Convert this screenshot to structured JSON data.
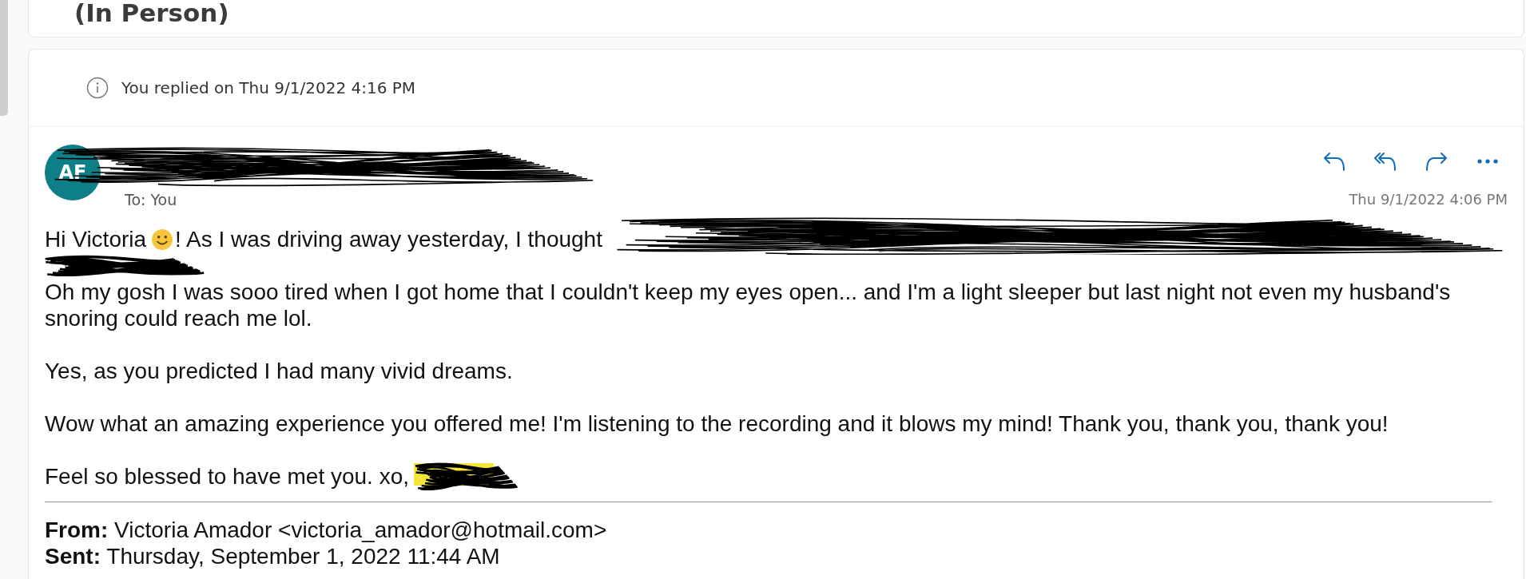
{
  "top_card": {
    "title": "(In Person)"
  },
  "info": {
    "text": "You replied on Thu 9/1/2022 4:16 PM"
  },
  "message": {
    "avatar": {
      "initials": "AF"
    },
    "to": "To: You",
    "actions": [
      {
        "kind": "reply"
      },
      {
        "kind": "reply_all"
      },
      {
        "kind": "forward"
      },
      {
        "kind": "more"
      }
    ],
    "date": "Thu 9/1/2022 4:06 PM",
    "greeting": {
      "before": "Hi Victoria",
      "after": "! As I was driving away yesterday, I thought"
    },
    "paragraphs": [
      "Oh my gosh I was sooo tired when I got home that I couldn't keep my eyes open... and I'm a light sleeper but last night not even my husband's snoring could reach me lol.",
      "Yes, as you predicted I had many vivid dreams.",
      "Wow what an amazing experience you offered me! I'm listening to the recording and it blows my mind! Thank you, thank you, thank you!"
    ],
    "signoff": "Feel so blessed to have met you. xo,",
    "quoted": [
      {
        "label": "From:",
        "value": "Victoria Amador <victoria_amador@hotmail.com>"
      },
      {
        "label": "Sent:",
        "value": "Thursday, September 1, 2022 11:44 AM"
      }
    ]
  }
}
